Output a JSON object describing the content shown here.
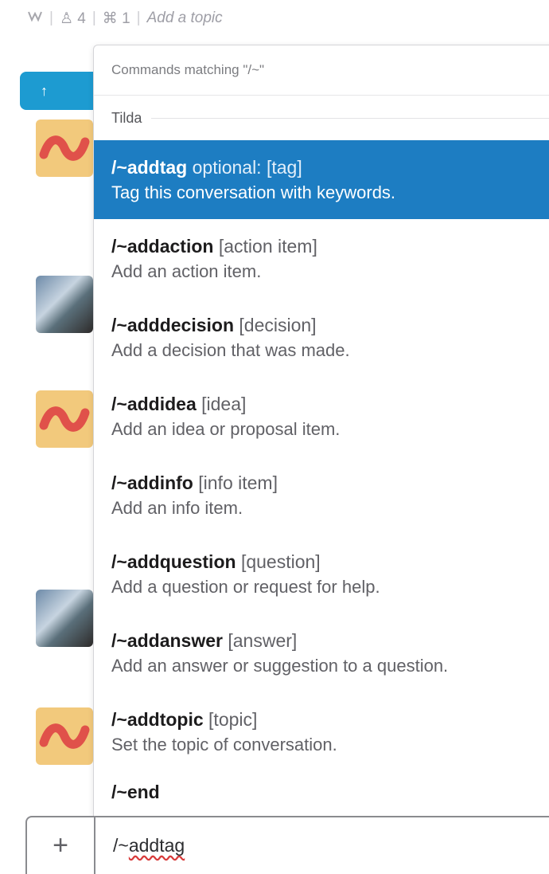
{
  "header": {
    "members_icon": "person-icon",
    "members_count": "4",
    "pins_icon": "pin-icon",
    "pins_count": "1",
    "topic_placeholder": "Add a topic",
    "star_icon": "star-icon"
  },
  "messages": {
    "jump_icon": "arrow-up-icon"
  },
  "autocomplete": {
    "header": "Commands matching \"/~\"",
    "group": "Tilda",
    "commands": [
      {
        "name": "/~addtag",
        "args": "optional: [tag]",
        "desc": "Tag this conversation with keywords.",
        "selected": true
      },
      {
        "name": "/~addaction",
        "args": "[action item]",
        "desc": "Add an action item."
      },
      {
        "name": "/~adddecision",
        "args": "[decision]",
        "desc": "Add a decision that was made."
      },
      {
        "name": "/~addidea",
        "args": "[idea]",
        "desc": "Add an idea or proposal item."
      },
      {
        "name": "/~addinfo",
        "args": "[info item]",
        "desc": "Add an info item."
      },
      {
        "name": "/~addquestion",
        "args": "[question]",
        "desc": "Add a question or request for help."
      },
      {
        "name": "/~addanswer",
        "args": "[answer]",
        "desc": "Add an answer or suggestion to a question."
      },
      {
        "name": "/~addtopic",
        "args": "[topic]",
        "desc": "Set the topic of conversation."
      },
      {
        "name": "/~end",
        "args": "",
        "desc": ""
      }
    ]
  },
  "composer": {
    "plus_label": "+",
    "text_prefix": "/~",
    "text_misspelled": "addtag"
  },
  "colors": {
    "selected_bg": "#1d7dc2",
    "jump_button": "#1d9bd1",
    "tilda_avatar_bg": "#f2c97c",
    "tilda_wave": "#e0514a"
  }
}
